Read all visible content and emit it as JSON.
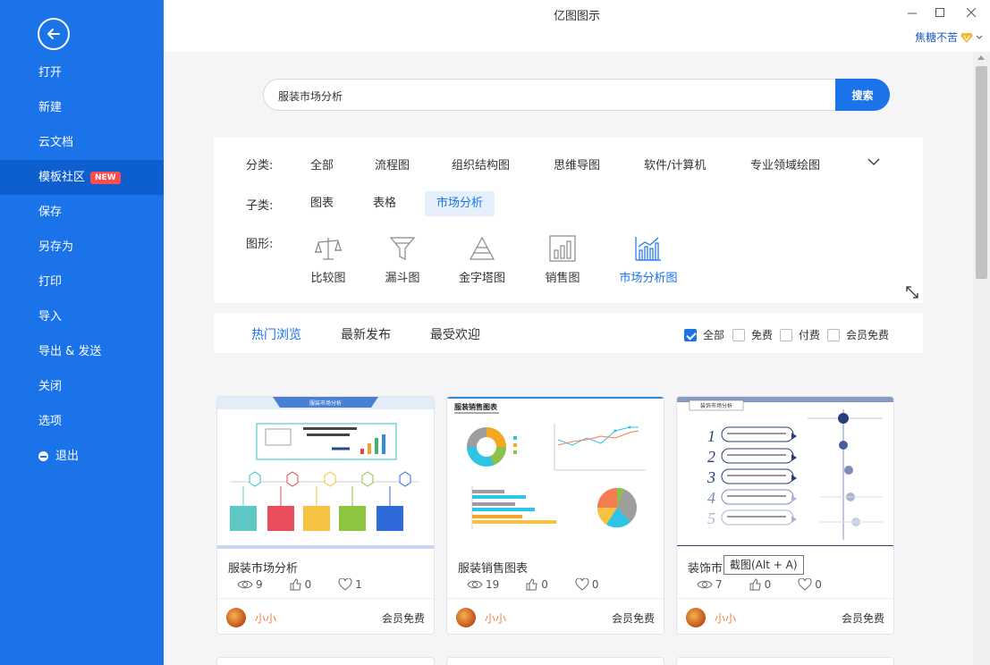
{
  "app": {
    "title": "亿图图示"
  },
  "user": {
    "name": "焦糖不苦"
  },
  "sidebar": {
    "items": [
      {
        "label": "打开"
      },
      {
        "label": "新建"
      },
      {
        "label": "云文档"
      },
      {
        "label": "模板社区",
        "badge": "NEW"
      },
      {
        "label": "保存"
      },
      {
        "label": "另存为"
      },
      {
        "label": "打印"
      },
      {
        "label": "导入"
      },
      {
        "label": "导出 & 发送"
      },
      {
        "label": "关闭"
      },
      {
        "label": "选项"
      },
      {
        "label": "退出"
      }
    ]
  },
  "search": {
    "value": "服装市场分析",
    "button": "搜索"
  },
  "filters": {
    "category_label": "分类:",
    "categories": [
      "全部",
      "流程图",
      "组织结构图",
      "思维导图",
      "软件/计算机",
      "专业领域绘图"
    ],
    "subcategory_label": "子类:",
    "subcategories": [
      "图表",
      "表格",
      "市场分析"
    ],
    "shape_label": "图形:",
    "shapes": [
      "比较图",
      "漏斗图",
      "金字塔图",
      "销售图",
      "市场分析图"
    ]
  },
  "tabs": [
    "热门浏览",
    "最新发布",
    "最受欢迎"
  ],
  "price_filters": [
    {
      "label": "全部",
      "checked": true
    },
    {
      "label": "免费",
      "checked": false
    },
    {
      "label": "付费",
      "checked": false
    },
    {
      "label": "会员免费",
      "checked": false
    }
  ],
  "cards": [
    {
      "title": "服装市场分析",
      "thumb_title": "服装市场分析",
      "views": "9",
      "likes": "0",
      "favorites": "1",
      "author": "小小",
      "price": "会员免费"
    },
    {
      "title": "服装销售图表",
      "thumb_title": "服装销售图表",
      "views": "19",
      "likes": "0",
      "favorites": "0",
      "author": "小小",
      "price": "会员免费"
    },
    {
      "title": "装饰市",
      "thumb_title": "装饰市场分析",
      "views": "7",
      "likes": "0",
      "favorites": "0",
      "author": "小小",
      "price": "会员免费"
    }
  ],
  "tooltip": {
    "text": "截图(Alt + A)"
  },
  "colors": {
    "sidebar": "#1a73e8",
    "accent": "#1a73e8",
    "author": "#f08040"
  }
}
